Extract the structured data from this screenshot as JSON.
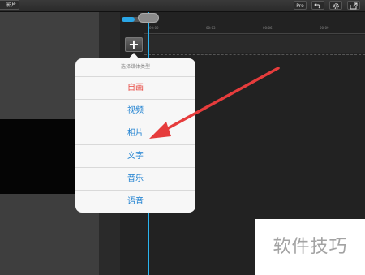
{
  "toolbar": {
    "left_button_label": "影片",
    "pro_label": "Pro",
    "undo_icon": "undo-icon",
    "settings_icon": "gear-icon",
    "share_icon": "share-icon"
  },
  "timeline": {
    "progress": 0.35,
    "ruler_labels": [
      "00:00",
      "00:03",
      "00:06",
      "00:09"
    ]
  },
  "add_button": {
    "label": "+"
  },
  "media_popup": {
    "title": "选择媒体类型",
    "items": [
      {
        "label": "自画",
        "color": "#e8463f"
      },
      {
        "label": "视频",
        "color": "#1b7fd0"
      },
      {
        "label": "相片",
        "color": "#1b7fd0"
      },
      {
        "label": "文字",
        "color": "#1b7fd0"
      },
      {
        "label": "音乐",
        "color": "#1b7fd0"
      },
      {
        "label": "语音",
        "color": "#1b7fd0"
      }
    ]
  },
  "annotation": {
    "arrow_color": "#e63c3c"
  },
  "watermark": {
    "text": "软件技巧"
  }
}
